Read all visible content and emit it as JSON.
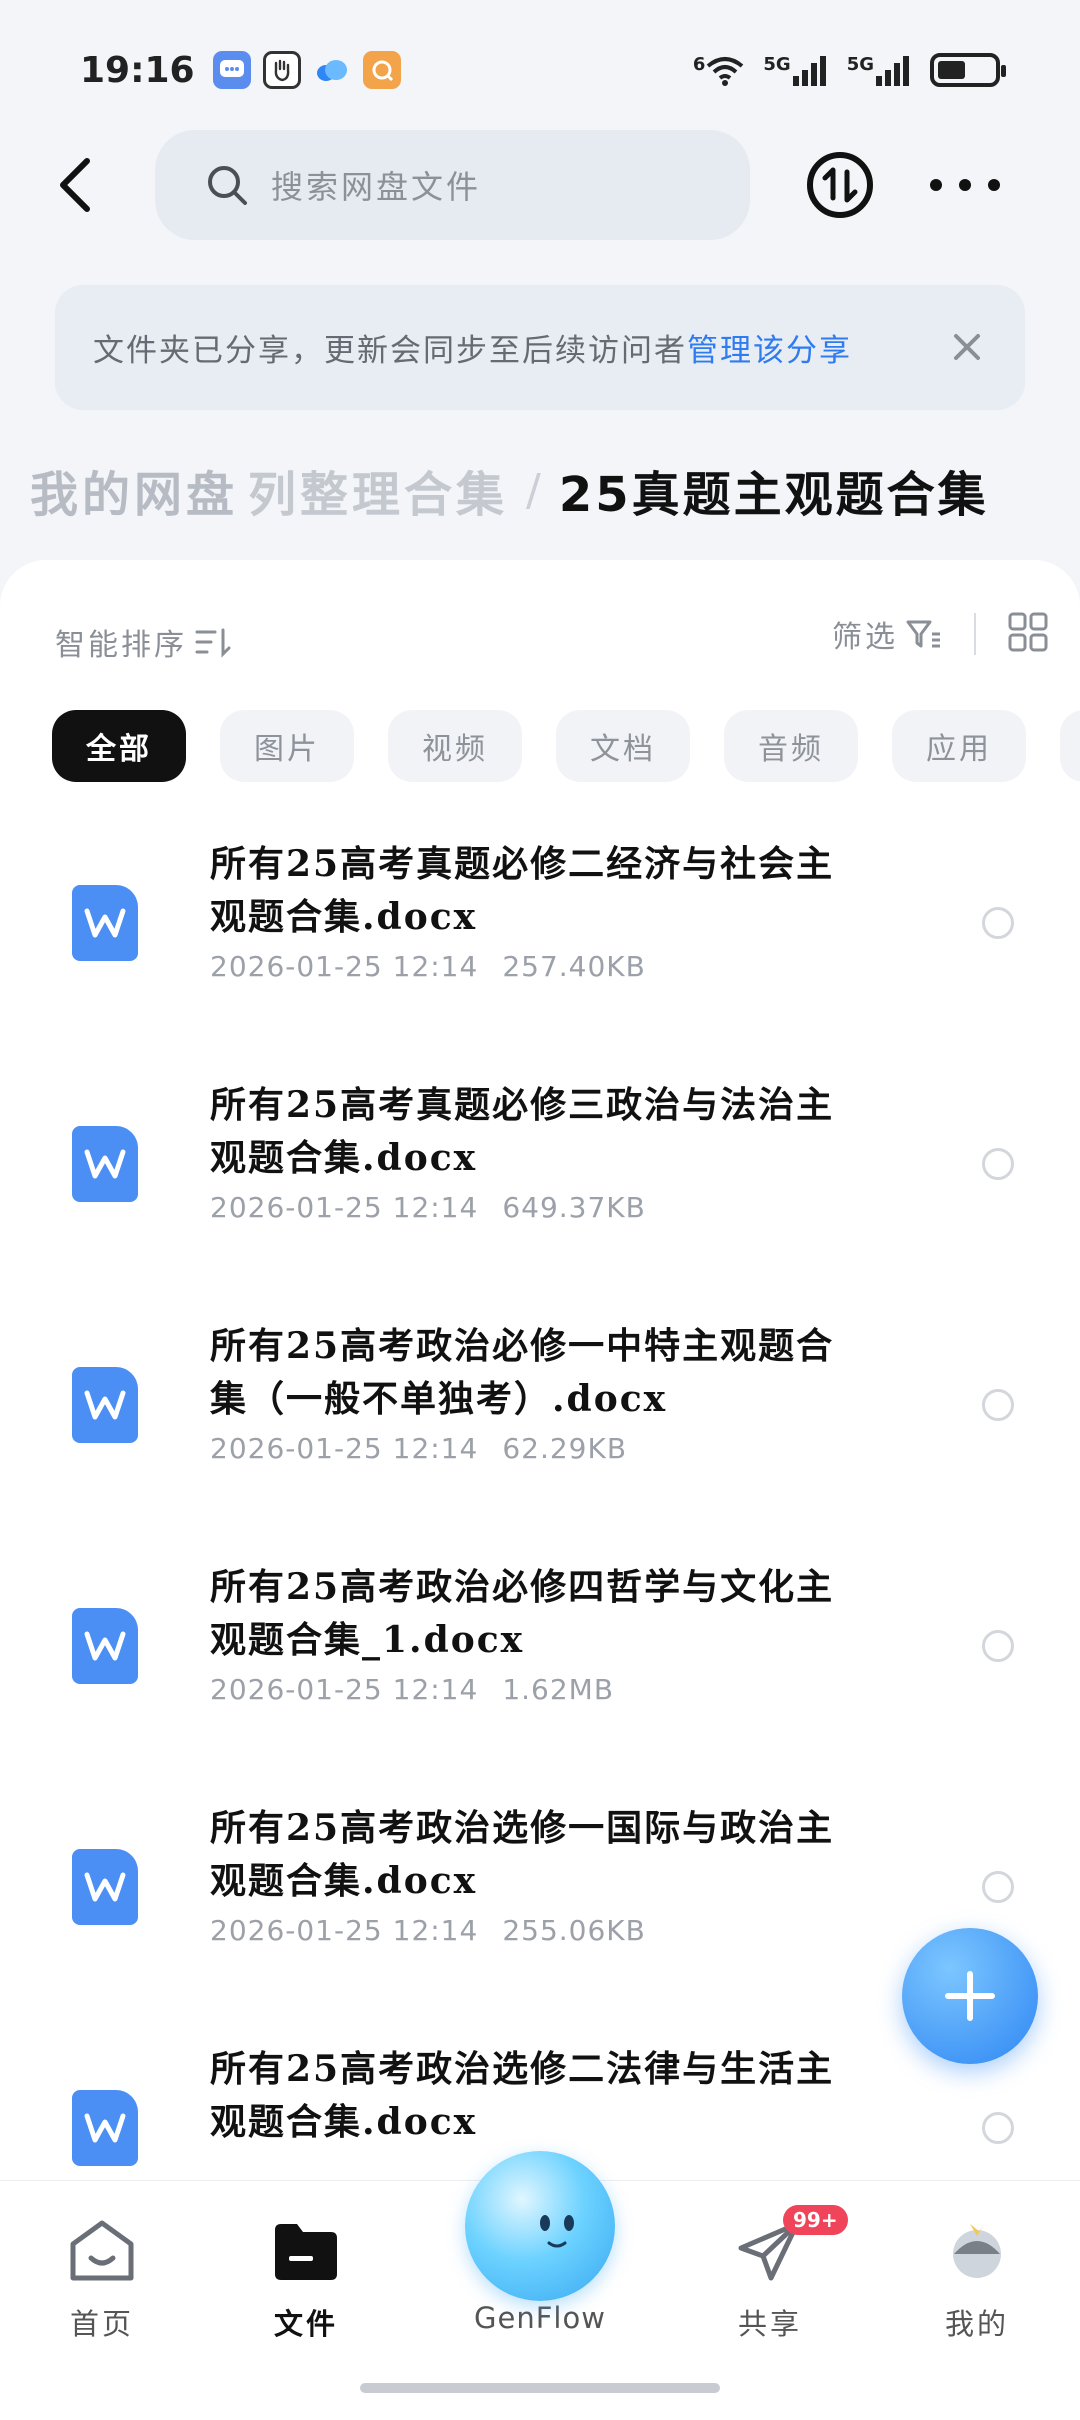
{
  "status_bar": {
    "time": "19:16",
    "network_1": "6",
    "network_2": "5G",
    "network_3": "5G",
    "battery_level": 0.5
  },
  "top_bar": {
    "search_placeholder": "搜索网盘文件"
  },
  "notice": {
    "text": "文件夹已分享，更新会同步至后续访问者",
    "link": "管理该分享"
  },
  "breadcrumb": {
    "root": "我的网盘",
    "middle": "列整理合集",
    "separator": "/",
    "current": "25真题主观题合集"
  },
  "toolbar": {
    "sort_label": "智能排序",
    "filter_label": "筛选"
  },
  "chips": [
    "全部",
    "图片",
    "视频",
    "文档",
    "音频",
    "应用"
  ],
  "files": [
    {
      "name_line1": "所有25高考真题必修二经济与社会主",
      "name_line2": "观题合集.docx",
      "date": "2026-01-25 12:14",
      "size": "257.40KB"
    },
    {
      "name_line1": "所有25高考真题必修三政治与法治主",
      "name_line2": "观题合集.docx",
      "date": "2026-01-25 12:14",
      "size": "649.37KB"
    },
    {
      "name_line1": "所有25高考政治必修一中特主观题合",
      "name_line2": "集（一般不单独考）.docx",
      "date": "2026-01-25 12:14",
      "size": "62.29KB"
    },
    {
      "name_line1": "所有25高考政治必修四哲学与文化主",
      "name_line2": "观题合集_1.docx",
      "date": "2026-01-25 12:14",
      "size": "1.62MB"
    },
    {
      "name_line1": "所有25高考政治选修一国际与政治主",
      "name_line2": "观题合集.docx",
      "date": "2026-01-25 12:14",
      "size": "255.06KB"
    },
    {
      "name_line1": "所有25高考政治选修二法律与生活主",
      "name_line2": "观题合集.docx",
      "date": "",
      "size": ""
    }
  ],
  "bottom_nav": {
    "home": "首页",
    "files": "文件",
    "genflow": "GenFlow",
    "share": "共享",
    "share_badge": "99+",
    "mine": "我的"
  },
  "colors": {
    "accent": "#2e7cf0",
    "word_icon": "#4b8ef4",
    "badge": "#f0445a"
  }
}
